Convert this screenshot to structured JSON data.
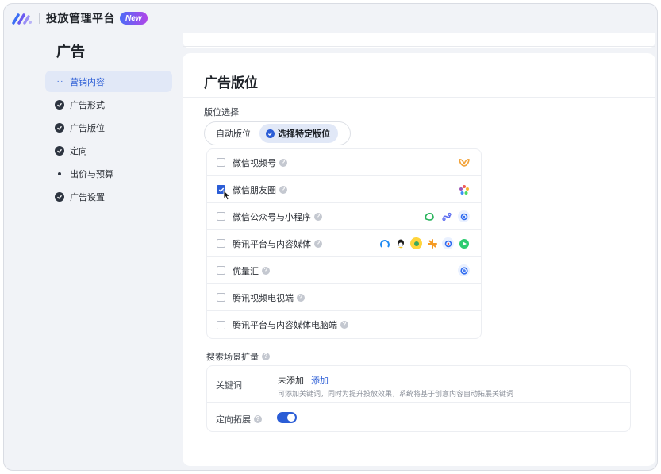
{
  "header": {
    "app_title": "投放管理平台",
    "badge": "New"
  },
  "sidebar": {
    "title": "广告",
    "items": [
      {
        "label": "营销内容",
        "state": "active"
      },
      {
        "label": "广告形式",
        "state": "done"
      },
      {
        "label": "广告版位",
        "state": "done"
      },
      {
        "label": "定向",
        "state": "done"
      },
      {
        "label": "出价与预算",
        "state": "pending"
      },
      {
        "label": "广告设置",
        "state": "done"
      }
    ]
  },
  "main": {
    "title": "广告版位",
    "placement_select": {
      "label": "版位选择",
      "options": [
        "自动版位",
        "选择特定版位"
      ],
      "selected": "选择特定版位"
    },
    "placements": [
      {
        "label": "微信视频号",
        "checked": false,
        "logos": [
          "channels-logo"
        ]
      },
      {
        "label": "微信朋友圈",
        "checked": true,
        "logos": [
          "moments-logo"
        ]
      },
      {
        "label": "微信公众号与小程序",
        "checked": false,
        "logos": [
          "official-account-logo",
          "mini-program-logo",
          "wechat-search-logo"
        ]
      },
      {
        "label": "腾讯平台与内容媒体",
        "checked": false,
        "logos": [
          "tencent-news-logo",
          "qq-logo",
          "qq-browser-logo",
          "tencent-app-logo",
          "tencent-video-logo",
          "play-logo"
        ]
      },
      {
        "label": "优量汇",
        "checked": false,
        "logos": [
          "youlianghui-logo"
        ]
      },
      {
        "label": "腾讯视频电视端",
        "checked": false,
        "logos": []
      },
      {
        "label": "腾讯平台与内容媒体电脑端",
        "checked": false,
        "logos": []
      }
    ],
    "search_expansion": {
      "title": "搜索场景扩量",
      "keyword_label": "关键词",
      "keyword_value": "未添加",
      "keyword_add": "添加",
      "keyword_desc": "可添加关键词，同时为提升投放效果，系统将基于创意内容自动拓展关键词",
      "targeting_label": "定向拓展",
      "targeting_enabled": true
    }
  },
  "colors": {
    "accent": "#2b5dd6",
    "badge_start": "#4c6cf7",
    "badge_end": "#b145e8"
  }
}
